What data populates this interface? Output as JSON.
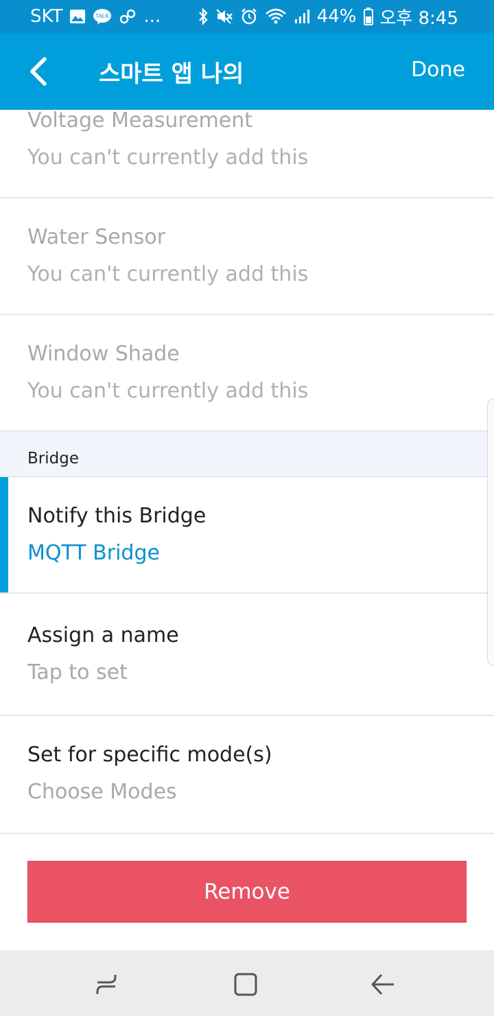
{
  "status_bar": {
    "carrier": "SKT",
    "more": "...",
    "battery": "44%",
    "time": "오후 8:45",
    "icons": [
      "gallery-icon",
      "kakaotalk-icon",
      "link-icon",
      "bluetooth-icon",
      "mute-icon",
      "alarm-icon",
      "wifi-icon",
      "signal-icon",
      "battery-icon"
    ]
  },
  "header": {
    "title": "스마트 앱 나의",
    "done_label": "Done",
    "background": "#009fdb"
  },
  "unavailable_items": [
    {
      "title": "Voltage Measurement",
      "subtitle": "You can't currently add this"
    },
    {
      "title": "Water Sensor",
      "subtitle": "You can't currently add this"
    },
    {
      "title": "Window Shade",
      "subtitle": "You can't currently add this"
    }
  ],
  "bridge_section": {
    "header": "Bridge",
    "notify": {
      "title": "Notify this Bridge",
      "value": "MQTT Bridge"
    },
    "name": {
      "title": "Assign a name",
      "subtitle": "Tap to set"
    },
    "modes": {
      "title": "Set for specific mode(s)",
      "subtitle": "Choose Modes"
    }
  },
  "remove_label": "Remove",
  "colors": {
    "accent": "#009fdb",
    "remove": "#e95364",
    "link": "#0a8fd0"
  },
  "nav_bar": {
    "icons": [
      "recent-apps-icon",
      "home-icon",
      "back-icon"
    ]
  }
}
